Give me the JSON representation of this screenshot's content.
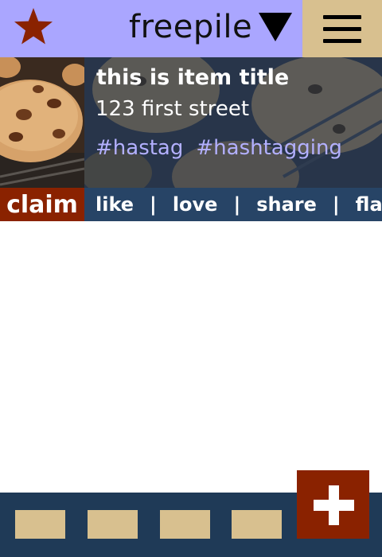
{
  "header": {
    "app_title": "freepile",
    "favorite_icon": "star-icon",
    "dropdown_icon": "caret-down-icon",
    "menu_icon": "hamburger-menu-icon"
  },
  "item": {
    "title": "this is item title",
    "address": "123 first street",
    "tags": [
      "#hastag",
      "#hashtagging"
    ],
    "claim_label": "claim",
    "actions": {
      "like": "like",
      "love": "love",
      "share": "share",
      "flag": "flag"
    },
    "separator": "|"
  },
  "bottom_bar": {
    "add_icon": "plus-icon"
  },
  "colors": {
    "header_bg": "#aaa6ff",
    "menu_bg": "#d8c08f",
    "accent_red": "#8a2200",
    "nav_bg": "#1f3a57",
    "actions_bg": "#274466",
    "tag_color": "#b3b0ff"
  }
}
